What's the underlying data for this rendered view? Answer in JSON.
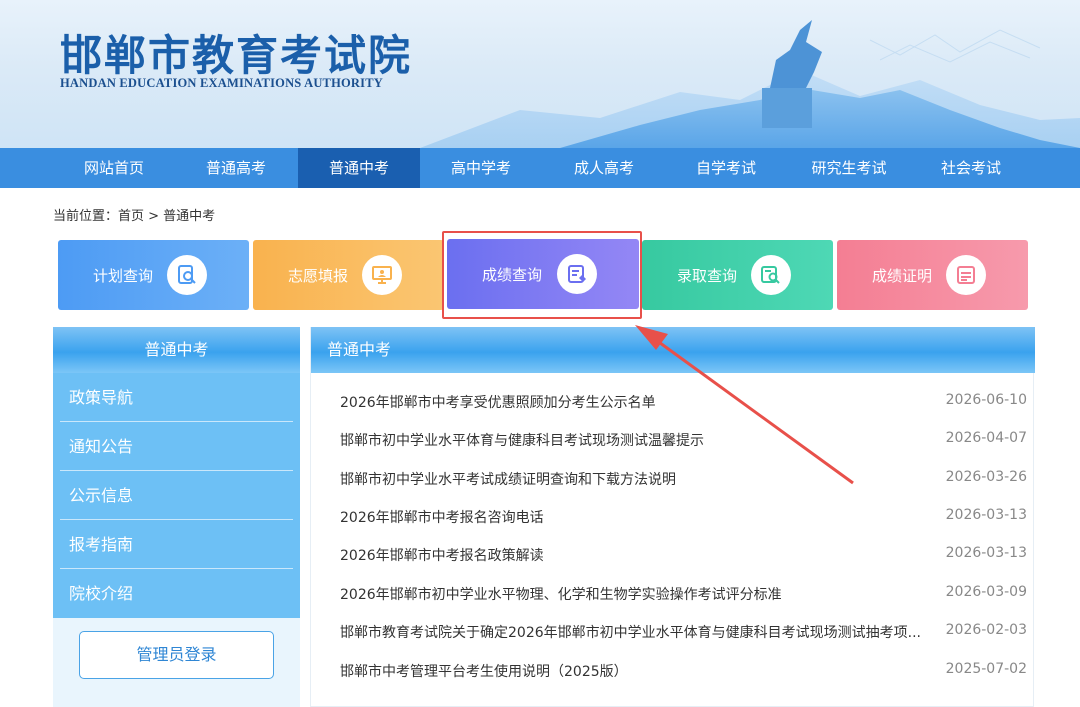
{
  "header": {
    "title": "邯郸市教育考试院",
    "subtitle": "HANDAN EDUCATION EXAMINATIONS AUTHORITY"
  },
  "nav": {
    "items": [
      "网站首页",
      "普通高考",
      "普通中考",
      "高中学考",
      "成人高考",
      "自学考试",
      "研究生考试",
      "社会考试"
    ],
    "active": "普通中考"
  },
  "breadcrumb": {
    "text": "当前位置：首页 > 普通中考"
  },
  "tiles": [
    {
      "label": "计划查询",
      "icon": "search-document-icon",
      "color": "#4d9bf4"
    },
    {
      "label": "志愿填报",
      "icon": "presentation-board-icon",
      "color": "#f9b24e"
    },
    {
      "label": "成绩查询",
      "icon": "score-card-icon",
      "color": "#6b6ff0"
    },
    {
      "label": "录取查询",
      "icon": "search-list-icon",
      "color": "#37c9a0"
    },
    {
      "label": "成绩证明",
      "icon": "certificate-icon",
      "color": "#f47e93"
    }
  ],
  "sidebar": {
    "title": "普通中考",
    "items": [
      {
        "label": "政策导航"
      },
      {
        "label": "通知公告"
      },
      {
        "label": "公示信息"
      },
      {
        "label": "报考指南"
      },
      {
        "label": "院校介绍"
      }
    ],
    "admin_login": "管理员登录"
  },
  "content": {
    "title": "普通中考",
    "news": [
      {
        "title": "2026年邯郸市中考享受优惠照顾加分考生公示名单",
        "date": "2026-06-10"
      },
      {
        "title": "邯郸市初中学业水平体育与健康科目考试现场测试温馨提示",
        "date": "2026-04-07"
      },
      {
        "title": "邯郸市初中学业水平考试成绩证明查询和下载方法说明",
        "date": "2026-03-26"
      },
      {
        "title": "2026年邯郸市中考报名咨询电话",
        "date": "2026-03-13"
      },
      {
        "title": "2026年邯郸市中考报名政策解读",
        "date": "2026-03-13"
      },
      {
        "title": "2026年邯郸市初中学业水平物理、化学和生物学实验操作考试评分标准",
        "date": "2026-03-09"
      },
      {
        "title": "邯郸市教育考试院关于确定2026年邯郸市初中学业水平体育与健康科目考试现场测试抽考项...",
        "date": "2026-02-03"
      },
      {
        "title": "邯郸市中考管理平台考生使用说明（2025版）",
        "date": "2025-07-02"
      }
    ]
  },
  "colors": {
    "nav_bg": "#3a8ee0",
    "nav_active": "#1a5fb0",
    "highlight": "#e8504a",
    "title_blue": "#1b5faa"
  }
}
